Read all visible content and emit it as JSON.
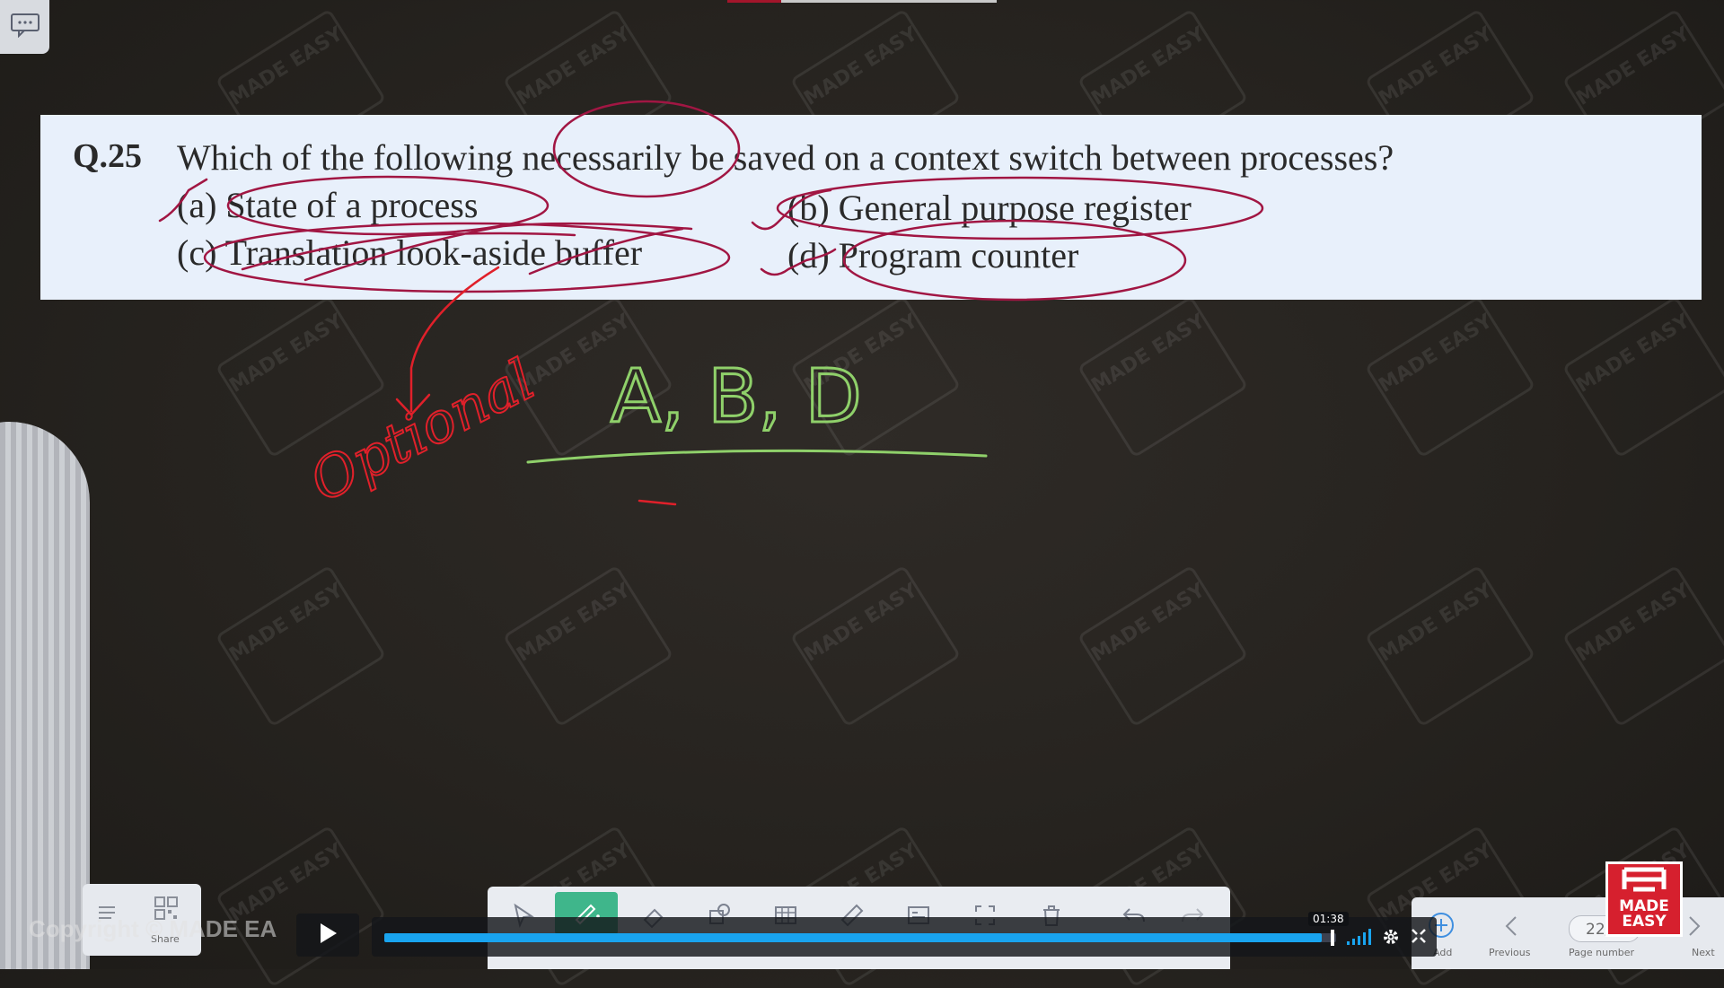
{
  "question": {
    "number": "Q.25",
    "stem": "Which of the following necessarily be saved on a context switch between processes?",
    "options": [
      {
        "label": "(a) State of a process"
      },
      {
        "label": "(b) General purpose register"
      },
      {
        "label": "(c) Translation look-aside buffer"
      },
      {
        "label": "(d) Program counter"
      }
    ]
  },
  "handwriting": {
    "answer": "A, B, D",
    "note": "Optional"
  },
  "watermark": "MADE EASY",
  "colors": {
    "panel_bg": "#e8f0fb",
    "ink_crimson": "#a11643",
    "ink_green": "#8fd06a",
    "ink_red": "#e0202a",
    "progress": "#19a4ef",
    "brand_red": "#d6202e"
  },
  "toolbars": {
    "left": {
      "share_label": "Share"
    },
    "right": {
      "add_label": "Add",
      "previous_label": "Previous",
      "page_number_value": "22/",
      "page_number_label": "Page number",
      "next_label": "Next"
    }
  },
  "video_player": {
    "copyright_text": "Copyright © MADE EA",
    "time_tooltip": "01:38",
    "progress_fraction": 0.985
  },
  "logo": {
    "line1": "MADE",
    "line2": "EASY"
  }
}
